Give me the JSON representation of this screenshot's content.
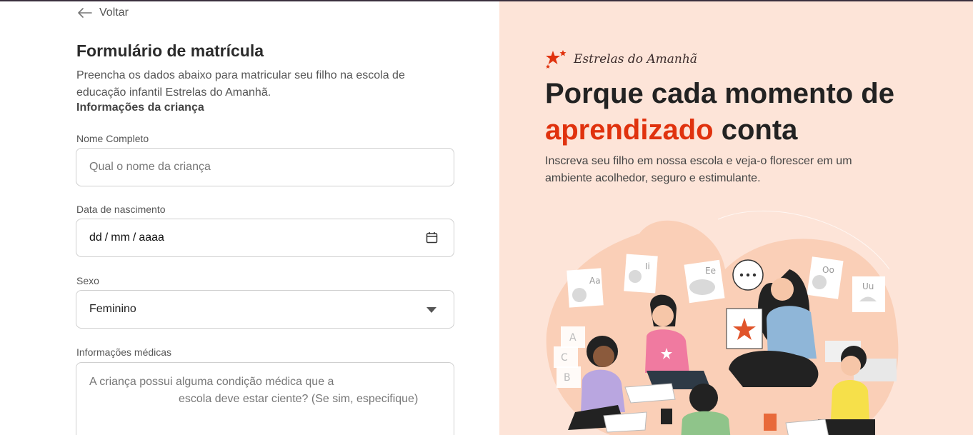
{
  "back": {
    "label": "Voltar"
  },
  "form": {
    "title": "Formulário de matrícula",
    "description": "Preencha os dados abaixo para matricular seu filho na escola de educação infantil Estrelas do Amanhã.",
    "section_title": "Informações da criança",
    "name": {
      "label": "Nome Completo",
      "placeholder": "Qual o nome da criança"
    },
    "birthdate": {
      "label": "Data de nascimento",
      "day": "dd",
      "month": "mm",
      "year": "aaaa",
      "sep": "/"
    },
    "sex": {
      "label": "Sexo",
      "value": "Feminino"
    },
    "medical": {
      "label": "Informações médicas",
      "placeholder_line1": "A criança possui alguma condição médica que a",
      "placeholder_line2": "escola deve estar ciente? (Se sim, especifique)"
    }
  },
  "promo": {
    "brand": "Estrelas do Amanhã",
    "headline_part1": "Porque cada momento de",
    "headline_accent": "aprendizado",
    "headline_part2": "conta",
    "subtext": "Inscreva seu filho em nossa escola e veja-o florescer em um ambiente acolhedor, seguro e estimulante.",
    "cards": [
      "Aa",
      "Ii",
      "Ee",
      "Oo",
      "Uu"
    ],
    "blocks": [
      "A",
      "C",
      "B"
    ],
    "accent_color": "#e0320e",
    "panel_color": "#fde4d8"
  }
}
